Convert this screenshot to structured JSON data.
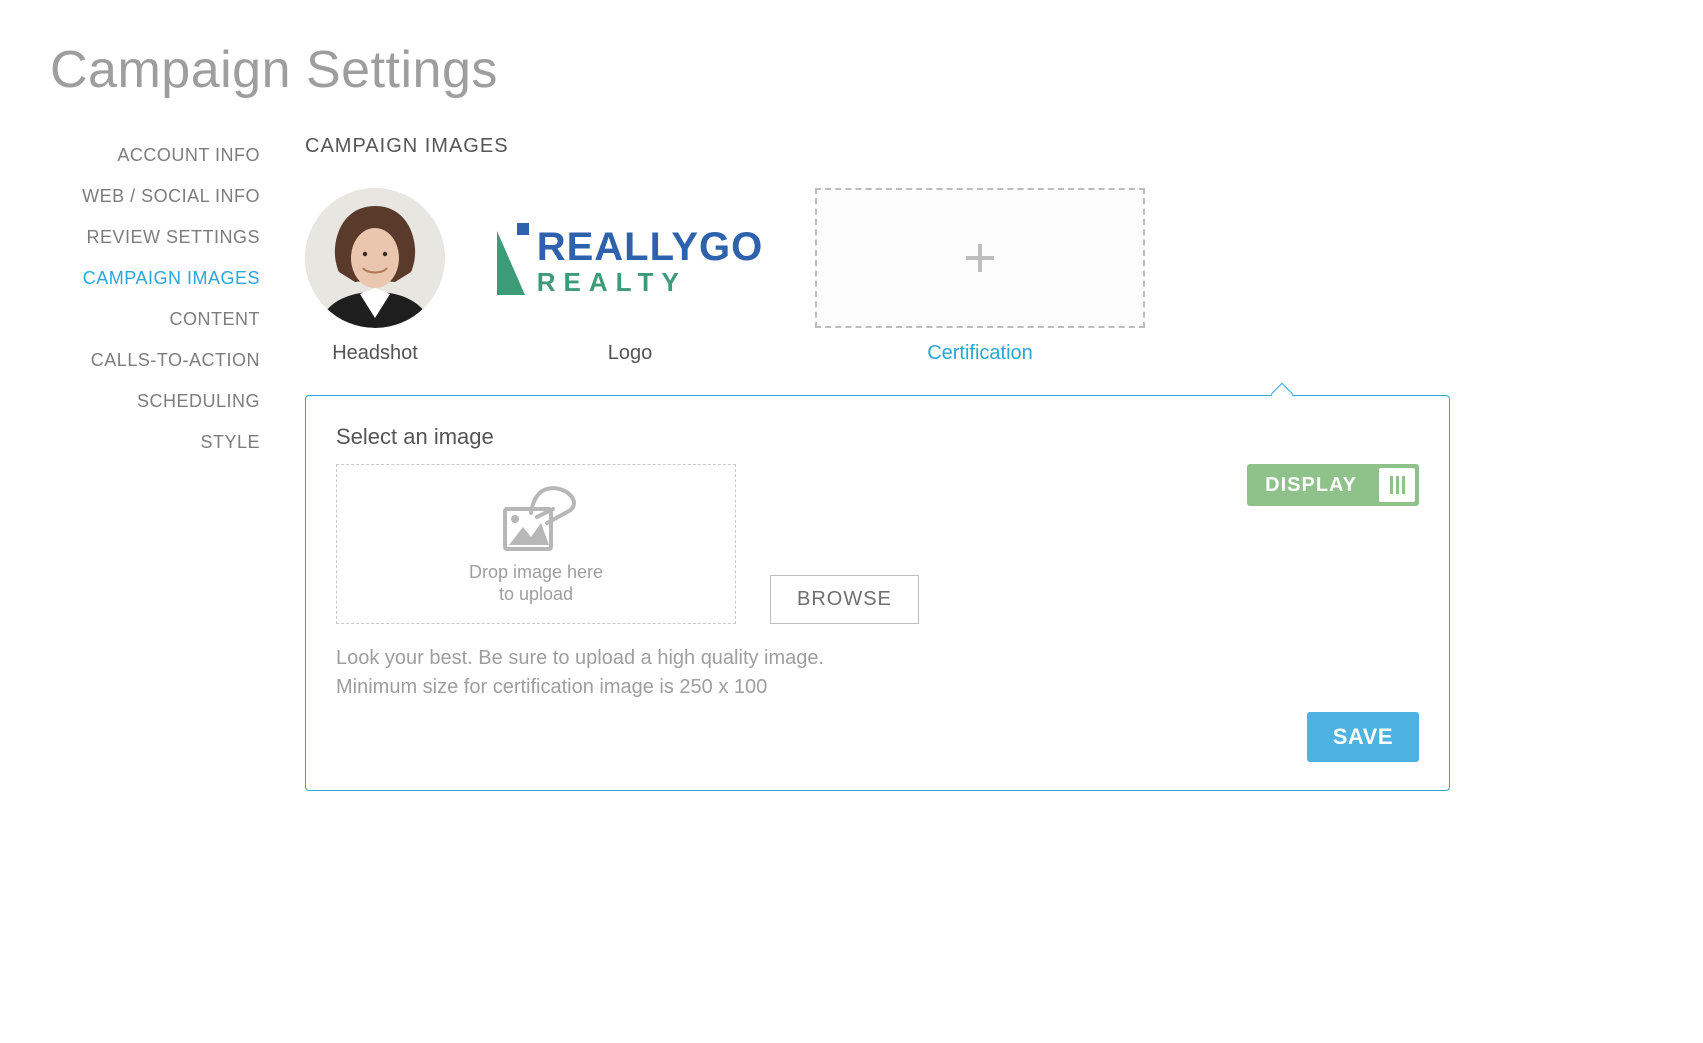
{
  "page": {
    "title": "Campaign Settings"
  },
  "sidebar": {
    "items": [
      {
        "label": "ACCOUNT INFO"
      },
      {
        "label": "WEB / SOCIAL INFO"
      },
      {
        "label": "REVIEW SETTINGS"
      },
      {
        "label": "CAMPAIGN IMAGES"
      },
      {
        "label": "CONTENT"
      },
      {
        "label": "CALLS-TO-ACTION"
      },
      {
        "label": "SCHEDULING"
      },
      {
        "label": "STYLE"
      }
    ],
    "active_index": 3
  },
  "main": {
    "section_title": "CAMPAIGN IMAGES",
    "slots": {
      "headshot": {
        "caption": "Headshot"
      },
      "logo": {
        "caption": "Logo",
        "brand_word1": "REALLYGO",
        "brand_word2": "REALTY"
      },
      "certification": {
        "caption": "Certification"
      }
    },
    "active_slot": "certification"
  },
  "panel": {
    "heading": "Select an image",
    "dropzone": {
      "line1": "Drop image here",
      "line2": "to upload"
    },
    "browse_label": "BROWSE",
    "display_toggle": {
      "label": "DISPLAY",
      "state": "on"
    },
    "hint_line1": "Look your best. Be sure to upload a high quality image.",
    "hint_line2": "Minimum size for certification image is 250 x 100",
    "save_label": "SAVE"
  }
}
